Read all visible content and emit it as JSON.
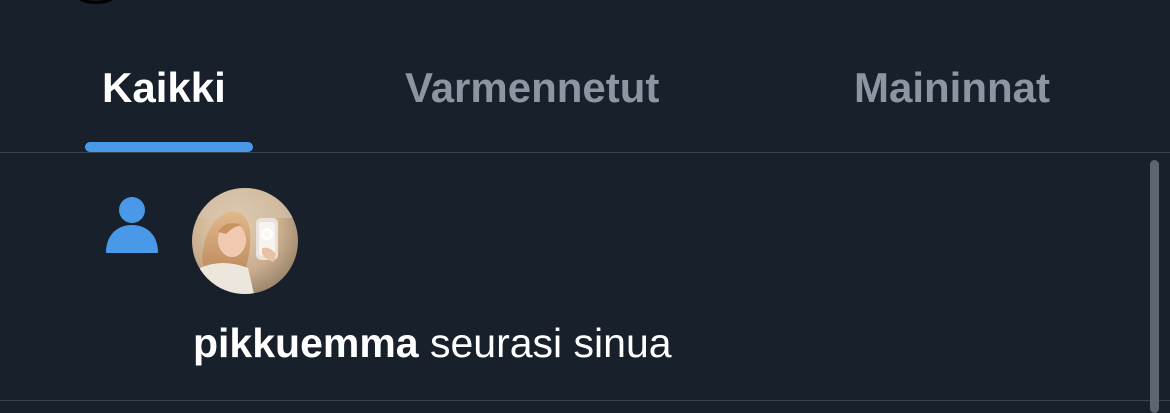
{
  "tabs": [
    {
      "label": "Kaikki",
      "active": true
    },
    {
      "label": "Varmennetut",
      "active": false
    },
    {
      "label": "Maininnat",
      "active": false
    }
  ],
  "notification": {
    "type_icon": "person-icon",
    "username": "pikkuemma",
    "action": " seurasi sinua"
  },
  "colors": {
    "background": "#17202b",
    "accent": "#4a99e9",
    "inactive_tab_text": "#8c96a3",
    "divider": "#3a4450"
  }
}
